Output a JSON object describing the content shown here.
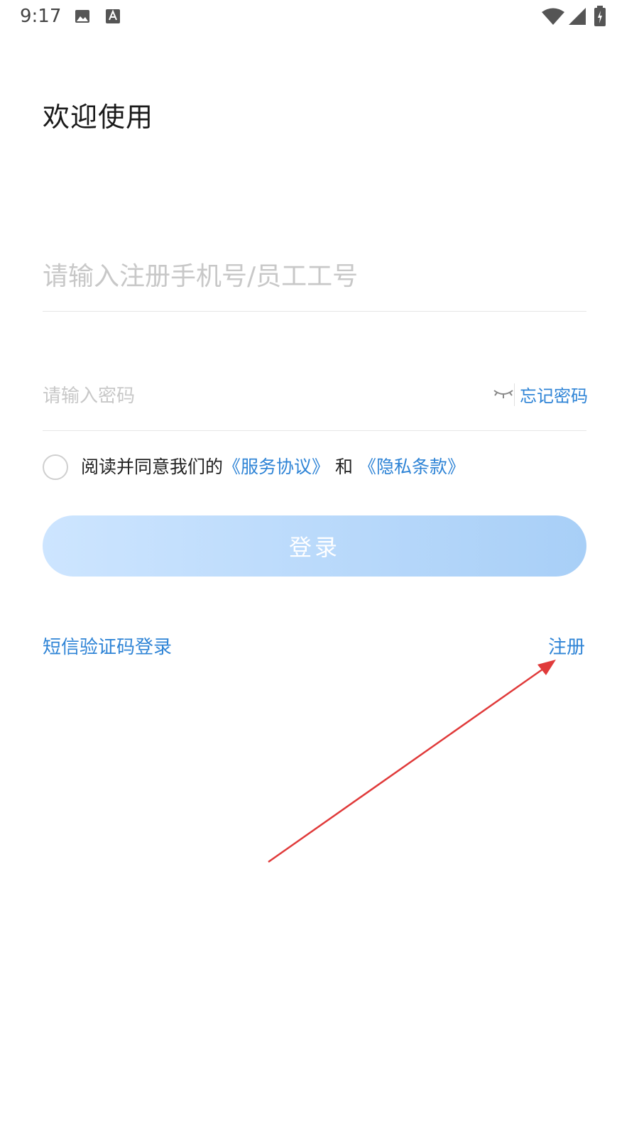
{
  "status_bar": {
    "time": "9:17",
    "icons": [
      "image-icon",
      "text-a-icon",
      "wifi-icon",
      "cellular-signal-icon",
      "battery-charging-icon"
    ]
  },
  "title": "欢迎使用",
  "account": {
    "placeholder": "请输入注册手机号/员工工号"
  },
  "password": {
    "placeholder": "请输入密码",
    "forgot_label": "忘记密码"
  },
  "agreement": {
    "prefix": "阅读并同意我们的",
    "service_label": "《服务协议》",
    "and": "和",
    "privacy_label": "《隐私条款》"
  },
  "login_button": "登录",
  "sms_login": "短信验证码登录",
  "register": "注册",
  "colors": {
    "link": "#2f84d6",
    "button_start": "#cde5ff",
    "button_end": "#a8cff7",
    "annotation_arrow": "#e03a3a"
  }
}
